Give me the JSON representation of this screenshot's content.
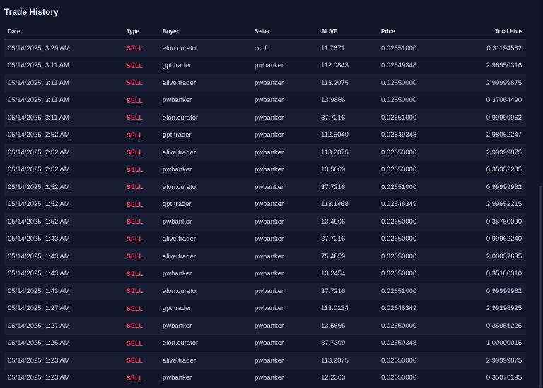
{
  "title": "Trade History",
  "columns": {
    "date": "Date",
    "type": "Type",
    "buyer": "Buyer",
    "seller": "Seller",
    "alive": "ALIVE",
    "price": "Price",
    "total": "Total Hive"
  },
  "rows": [
    {
      "date": "05/14/2025, 3:29 AM",
      "type": "SELL",
      "buyer": "elon.curator",
      "seller": "cccf",
      "alive": "11.7671",
      "price": "0.02651000",
      "total": "0.31194582"
    },
    {
      "date": "05/14/2025, 3:11 AM",
      "type": "SELL",
      "buyer": "gpt.trader",
      "seller": "pwbanker",
      "alive": "112.0843",
      "price": "0.02649348",
      "total": "2.96950316"
    },
    {
      "date": "05/14/2025, 3:11 AM",
      "type": "SELL",
      "buyer": "alive.trader",
      "seller": "pwbanker",
      "alive": "113.2075",
      "price": "0.02650000",
      "total": "2.99999875"
    },
    {
      "date": "05/14/2025, 3:11 AM",
      "type": "SELL",
      "buyer": "pwbanker",
      "seller": "pwbanker",
      "alive": "13.9866",
      "price": "0.02650000",
      "total": "0.37064490"
    },
    {
      "date": "05/14/2025, 3:11 AM",
      "type": "SELL",
      "buyer": "elon.curator",
      "seller": "pwbanker",
      "alive": "37.7216",
      "price": "0.02651000",
      "total": "0.99999962"
    },
    {
      "date": "05/14/2025, 2:52 AM",
      "type": "SELL",
      "buyer": "gpt.trader",
      "seller": "pwbanker",
      "alive": "112.5040",
      "price": "0.02649348",
      "total": "2.98062247"
    },
    {
      "date": "05/14/2025, 2:52 AM",
      "type": "SELL",
      "buyer": "alive.trader",
      "seller": "pwbanker",
      "alive": "113.2075",
      "price": "0.02650000",
      "total": "2.99999875"
    },
    {
      "date": "05/14/2025, 2:52 AM",
      "type": "SELL",
      "buyer": "pwbanker",
      "seller": "pwbanker",
      "alive": "13.5669",
      "price": "0.02650000",
      "total": "0.35952285"
    },
    {
      "date": "05/14/2025, 2:52 AM",
      "type": "SELL",
      "buyer": "elon.curator",
      "seller": "pwbanker",
      "alive": "37.7216",
      "price": "0.02651000",
      "total": "0.99999962"
    },
    {
      "date": "05/14/2025, 1:52 AM",
      "type": "SELL",
      "buyer": "gpt.trader",
      "seller": "pwbanker",
      "alive": "113.1468",
      "price": "0.02648349",
      "total": "2.99652215"
    },
    {
      "date": "05/14/2025, 1:52 AM",
      "type": "SELL",
      "buyer": "pwbanker",
      "seller": "pwbanker",
      "alive": "13.4906",
      "price": "0.02650000",
      "total": "0.35750090"
    },
    {
      "date": "05/14/2025, 1:43 AM",
      "type": "SELL",
      "buyer": "alive.trader",
      "seller": "pwbanker",
      "alive": "37.7216",
      "price": "0.02650000",
      "total": "0.99962240"
    },
    {
      "date": "05/14/2025, 1:43 AM",
      "type": "SELL",
      "buyer": "alive.trader",
      "seller": "pwbanker",
      "alive": "75.4859",
      "price": "0.02650000",
      "total": "2.00037635"
    },
    {
      "date": "05/14/2025, 1:43 AM",
      "type": "SELL",
      "buyer": "pwbanker",
      "seller": "pwbanker",
      "alive": "13.2454",
      "price": "0.02650000",
      "total": "0.35100310"
    },
    {
      "date": "05/14/2025, 1:43 AM",
      "type": "SELL",
      "buyer": "elon.curator",
      "seller": "pwbanker",
      "alive": "37.7216",
      "price": "0.02651000",
      "total": "0.99999962"
    },
    {
      "date": "05/14/2025, 1:27 AM",
      "type": "SELL",
      "buyer": "gpt.trader",
      "seller": "pwbanker",
      "alive": "113.0134",
      "price": "0.02648349",
      "total": "2.99298925"
    },
    {
      "date": "05/14/2025, 1:27 AM",
      "type": "SELL",
      "buyer": "pwbanker",
      "seller": "pwbanker",
      "alive": "13.5665",
      "price": "0.02650000",
      "total": "0.35951225"
    },
    {
      "date": "05/14/2025, 1:25 AM",
      "type": "SELL",
      "buyer": "elon.curator",
      "seller": "pwbanker",
      "alive": "37.7309",
      "price": "0.02650348",
      "total": "1.00000015"
    },
    {
      "date": "05/14/2025, 1:23 AM",
      "type": "SELL",
      "buyer": "alive.trader",
      "seller": "pwbanker",
      "alive": "113.2075",
      "price": "0.02650000",
      "total": "2.99999875"
    },
    {
      "date": "05/14/2025, 1:23 AM",
      "type": "SELL",
      "buyer": "pwbanker",
      "seller": "pwbanker",
      "alive": "12.2363",
      "price": "0.02650000",
      "total": "0.35076195"
    }
  ],
  "colors": {
    "background": "#12162a",
    "row_alt": "#181d33",
    "sell": "#e8384f",
    "text": "#cfd3df"
  }
}
